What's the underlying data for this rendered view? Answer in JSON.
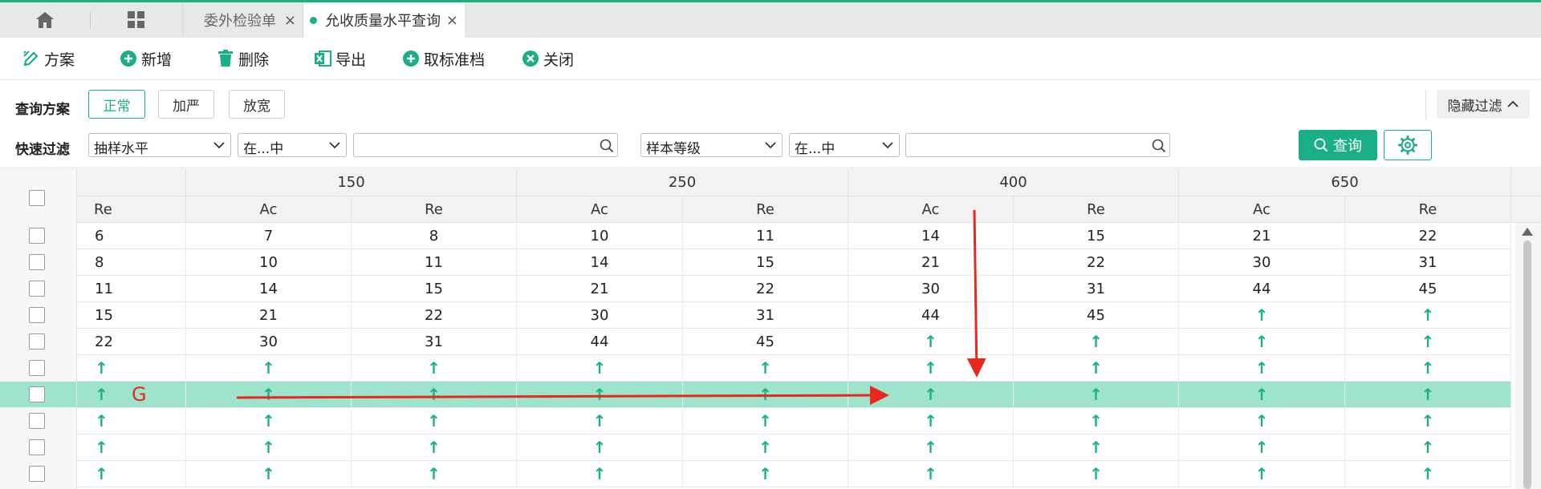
{
  "tabs": {
    "items": [
      {
        "label": "委外检验单",
        "active": false
      },
      {
        "label": "允收质量水平查询",
        "active": true
      }
    ],
    "close_glyph": "×"
  },
  "toolbar": {
    "items": [
      {
        "label": "方案",
        "icon": "edit-icon"
      },
      {
        "label": "新增",
        "icon": "plus-circle-icon"
      },
      {
        "label": "删除",
        "icon": "trash-icon"
      },
      {
        "label": "导出",
        "icon": "excel-icon"
      },
      {
        "label": "取标准档",
        "icon": "plus-circle-icon"
      },
      {
        "label": "关闭",
        "icon": "close-circle-icon"
      }
    ]
  },
  "filter": {
    "scheme_label": "查询方案",
    "schemes": [
      "正常",
      "加严",
      "放宽"
    ],
    "active_scheme": "正常",
    "hide_filter_label": "隐藏过滤",
    "quick_label": "快速过滤",
    "field1": "抽样水平",
    "op1": "在...中",
    "value1": "",
    "field2": "样本等级",
    "op2": "在...中",
    "value2": "",
    "query_label": "查询"
  },
  "grid": {
    "group_headers": [
      "150",
      "250",
      "400",
      "650"
    ],
    "first_sub_header": "Re",
    "sub_headers": [
      "Ac",
      "Re",
      "Ac",
      "Re",
      "Ac",
      "Re",
      "Ac",
      "Re"
    ],
    "arrow_glyph": "↑",
    "rows": [
      [
        "6",
        "7",
        "8",
        "10",
        "11",
        "14",
        "15",
        "21",
        "22"
      ],
      [
        "8",
        "10",
        "11",
        "14",
        "15",
        "21",
        "22",
        "30",
        "31"
      ],
      [
        "11",
        "14",
        "15",
        "21",
        "22",
        "30",
        "31",
        "44",
        "45"
      ],
      [
        "15",
        "21",
        "22",
        "30",
        "31",
        "44",
        "45",
        "↑",
        "↑"
      ],
      [
        "22",
        "30",
        "31",
        "44",
        "45",
        "↑",
        "↑",
        "↑",
        "↑"
      ],
      [
        "↑",
        "↑",
        "↑",
        "↑",
        "↑",
        "↑",
        "↑",
        "↑",
        "↑"
      ],
      [
        "↑",
        "↑",
        "↑",
        "↑",
        "↑",
        "↑",
        "↑",
        "↑",
        "↑"
      ],
      [
        "↑",
        "↑",
        "↑",
        "↑",
        "↑",
        "↑",
        "↑",
        "↑",
        "↑"
      ],
      [
        "↑",
        "↑",
        "↑",
        "↑",
        "↑",
        "↑",
        "↑",
        "↑",
        "↑"
      ],
      [
        "↑",
        "↑",
        "↑",
        "↑",
        "↑",
        "↑",
        "↑",
        "↑",
        "↑"
      ]
    ],
    "selected_row": 6,
    "annotation_letter": "G",
    "annotation_color": "#e8281e",
    "accent_color": "#1aaf86"
  }
}
